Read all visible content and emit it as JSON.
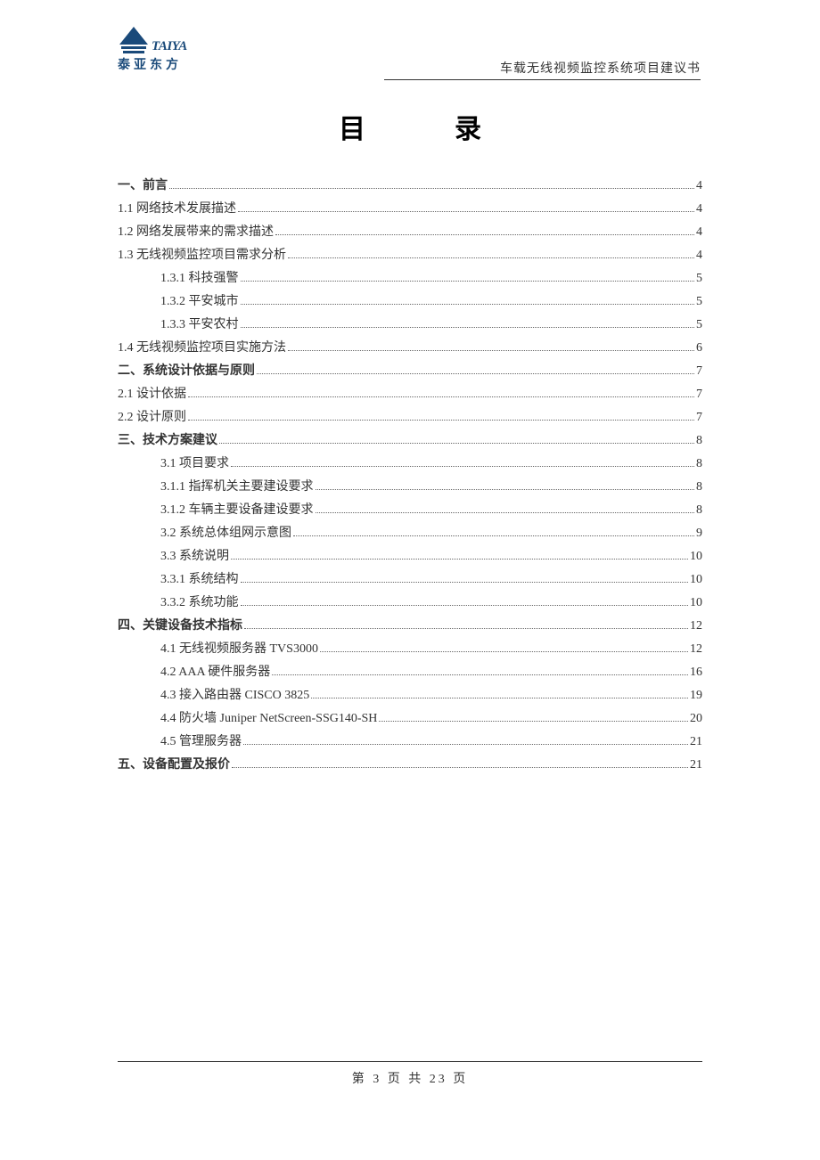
{
  "logo": {
    "brand": "TAIYA",
    "brand_cn": "泰亚东方"
  },
  "header": {
    "subtitle": "车载无线视频监控系统项目建议书"
  },
  "title": {
    "char1": "目",
    "char2": "录"
  },
  "toc": [
    {
      "label": "一、前言",
      "page": "4",
      "indent": 0,
      "bold": true
    },
    {
      "label": "1.1 网络技术发展描述",
      "page": "4",
      "indent": 0,
      "bold": false
    },
    {
      "label": "1.2 网络发展带来的需求描述",
      "page": "4",
      "indent": 0,
      "bold": false
    },
    {
      "label": "1.3 无线视频监控项目需求分析",
      "page": "4",
      "indent": 0,
      "bold": false
    },
    {
      "label": "1.3.1 科技强警",
      "page": "5",
      "indent": 1,
      "bold": false
    },
    {
      "label": "1.3.2 平安城市",
      "page": "5",
      "indent": 1,
      "bold": false
    },
    {
      "label": "1.3.3 平安农村",
      "page": "5",
      "indent": 1,
      "bold": false
    },
    {
      "label": "1.4 无线视频监控项目实施方法",
      "page": "6",
      "indent": 0,
      "bold": false
    },
    {
      "label": "二、系统设计依据与原则",
      "page": "7",
      "indent": 0,
      "bold": true
    },
    {
      "label": "2.1 设计依据",
      "page": "7",
      "indent": 0,
      "bold": false
    },
    {
      "label": "2.2  设计原则",
      "page": "7",
      "indent": 0,
      "bold": false
    },
    {
      "label": "三、技术方案建议",
      "page": "8",
      "indent": 0,
      "bold": true
    },
    {
      "label": "3.1 项目要求",
      "page": "8",
      "indent": 1,
      "bold": false
    },
    {
      "label": "3.1.1 指挥机关主要建设要求",
      "page": "8",
      "indent": 1,
      "bold": false
    },
    {
      "label": "3.1.2 车辆主要设备建设要求",
      "page": "8",
      "indent": 1,
      "bold": false
    },
    {
      "label": "3.2 系统总体组网示意图",
      "page": "9",
      "indent": 1,
      "bold": false
    },
    {
      "label": "3.3 系统说明",
      "page": "10",
      "indent": 1,
      "bold": false
    },
    {
      "label": "3.3.1 系统结构",
      "page": "10",
      "indent": 1,
      "bold": false
    },
    {
      "label": "3.3.2 系统功能",
      "page": "10",
      "indent": 1,
      "bold": false
    },
    {
      "label": "四、关键设备技术指标",
      "page": "12",
      "indent": 0,
      "bold": true
    },
    {
      "label": "4.1 无线视频服务器 TVS3000",
      "page": "12",
      "indent": 1,
      "bold": false
    },
    {
      "label": "4.2 AAA 硬件服务器",
      "page": "16",
      "indent": 1,
      "bold": false
    },
    {
      "label": "4.3 接入路由器 CISCO 3825",
      "page": "19",
      "indent": 1,
      "bold": false
    },
    {
      "label": "4.4 防火墙 Juniper NetScreen-SSG140-SH",
      "page": "20",
      "indent": 1,
      "bold": false
    },
    {
      "label": "4.5 管理服务器",
      "page": "21",
      "indent": 1,
      "bold": false
    },
    {
      "label": "五、设备配置及报价",
      "page": "21",
      "indent": 0,
      "bold": true
    }
  ],
  "footer": {
    "text": "第 3 页 共 23 页"
  }
}
